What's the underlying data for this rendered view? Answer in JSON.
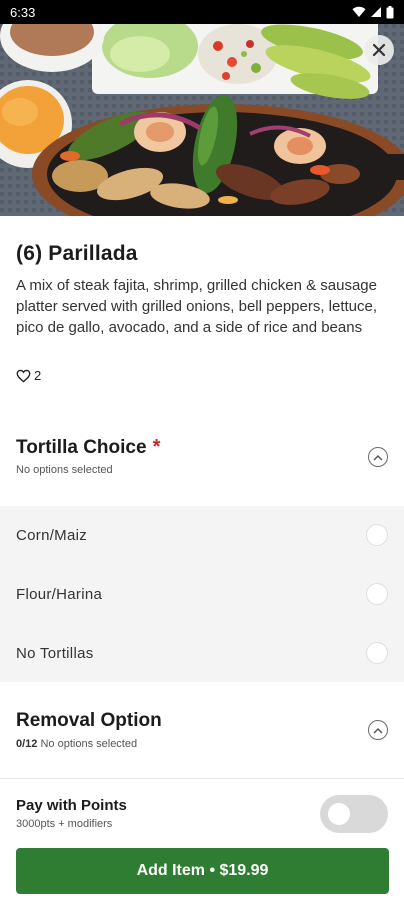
{
  "status_bar": {
    "time": "6:33"
  },
  "item": {
    "title": "(6) Parillada",
    "description": "A mix of steak fajita, shrimp, grilled chicken & sausage platter served with grilled onions, bell peppers, lettuce, pico de gallo, avocado, and a side of rice and beans",
    "likes": "2"
  },
  "tortilla_section": {
    "title": "Tortilla Choice",
    "required_marker": "*",
    "subtitle": "No options selected",
    "options": [
      {
        "label": "Corn/Maiz",
        "selected": false
      },
      {
        "label": "Flour/Harina",
        "selected": false
      },
      {
        "label": "No Tortillas",
        "selected": false
      }
    ]
  },
  "removal_section": {
    "title": "Removal Option",
    "count": "0/12",
    "subtitle": "No options selected"
  },
  "points": {
    "title": "Pay with Points",
    "subtitle": "3000pts + modifiers",
    "enabled": false
  },
  "add_button": {
    "label": "Add Item • $19.99"
  },
  "colors": {
    "primary_green": "#2e7d32",
    "required_red": "#c62828",
    "options_bg": "#f4f4f4",
    "toggle_off": "#d9d9d9"
  },
  "icons": [
    "wifi-icon",
    "signal-icon",
    "battery-icon",
    "close-icon",
    "heart-icon",
    "chevron-up-icon"
  ]
}
